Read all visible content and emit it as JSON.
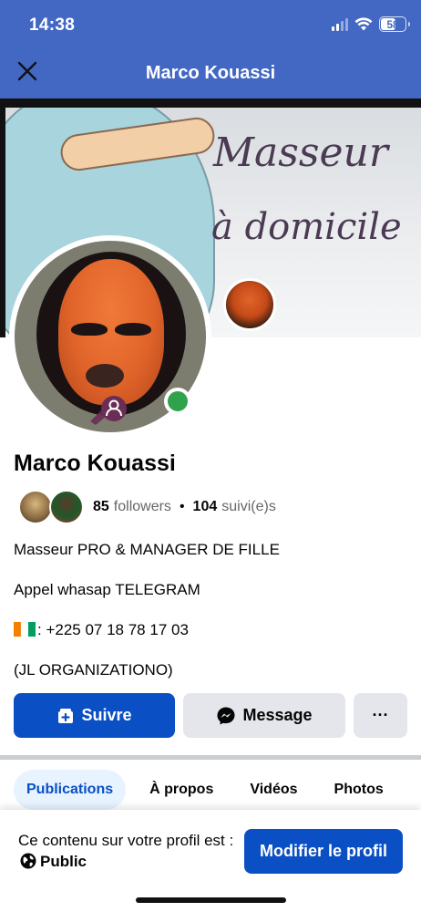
{
  "status_bar": {
    "time": "14:38",
    "battery": "58"
  },
  "header": {
    "title": "Marco Kouassi",
    "close_icon": "close-icon"
  },
  "cover": {
    "line1": "Masseur",
    "line2": "à domicile"
  },
  "profile": {
    "name": "Marco Kouassi",
    "followers_count": "85",
    "followers_label": "followers",
    "separator": "•",
    "following_count": "104",
    "following_label": "suivi(e)s",
    "online_color": "#31a24c",
    "bio": [
      "Masseur PRO & MANAGER DE FILLE",
      "Appel whasap TELEGRAM",
      ": +225 07 18 78 17 03",
      "(JL ORGANIZATIONO)"
    ]
  },
  "actions": {
    "follow_label": "Suivre",
    "message_label": "Message",
    "more_label": "···"
  },
  "tabs": [
    {
      "label": "Publications",
      "active": true
    },
    {
      "label": "À propos",
      "active": false
    },
    {
      "label": "Vidéos",
      "active": false
    },
    {
      "label": "Photos",
      "active": false
    }
  ],
  "banner": {
    "text_prefix": "Ce contenu sur votre profil est :",
    "visibility": "Public",
    "edit_label": "Modifier le profil"
  },
  "colors": {
    "accent": "#0b4fc4",
    "header_bg": "#4368c4"
  }
}
